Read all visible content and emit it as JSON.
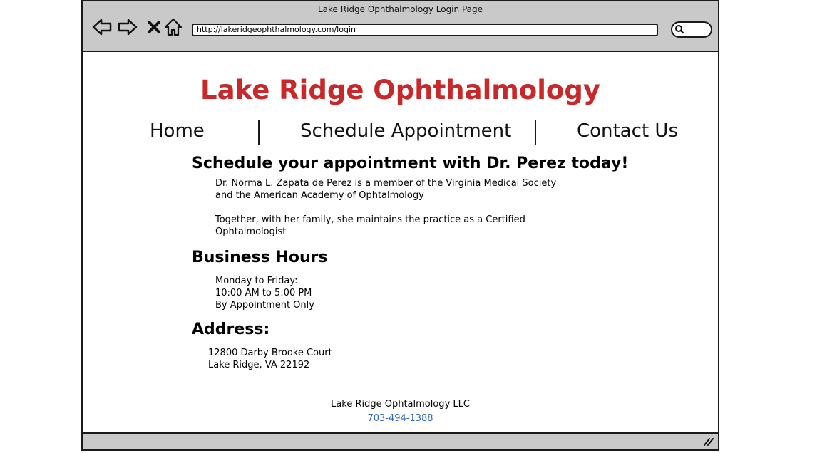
{
  "window": {
    "title": "Lake Ridge Ophthalmology Login Page"
  },
  "browser": {
    "url": "http://lakeridgeophthalmology.com/login",
    "icons": [
      "back-arrow-icon",
      "forward-arrow-icon",
      "close-icon",
      "home-icon",
      "search-icon",
      "resize-grip-icon"
    ]
  },
  "site": {
    "title": "Lake Ridge Ophthalmology",
    "accent_color": "#c8282a",
    "nav": [
      "Home",
      "Schedule Appointment",
      "Contact Us"
    ]
  },
  "intro": {
    "heading": "Schedule your appointment with Dr. Perez today!",
    "lines": [
      "Dr. Norma L. Zapata de Perez is a member of the Virginia Medical Society",
      "and the American Academy of Ophtalmology",
      "Together, with her family, she maintains the practice as a Certified",
      "Ophtalmologist"
    ]
  },
  "hours": {
    "heading": "Business Hours",
    "lines": [
      "Monday to Friday:",
      "10:00 AM to 5:00 PM",
      "By Appointment Only"
    ]
  },
  "address": {
    "heading": "Address:",
    "lines": [
      "12800 Darby Brooke Court",
      "Lake Ridge, VA 22192"
    ]
  },
  "footer": {
    "company": "Lake Ridge Ophtalmology LLC",
    "phone": "703-494-1388",
    "phone_color": "#2f66c2"
  }
}
